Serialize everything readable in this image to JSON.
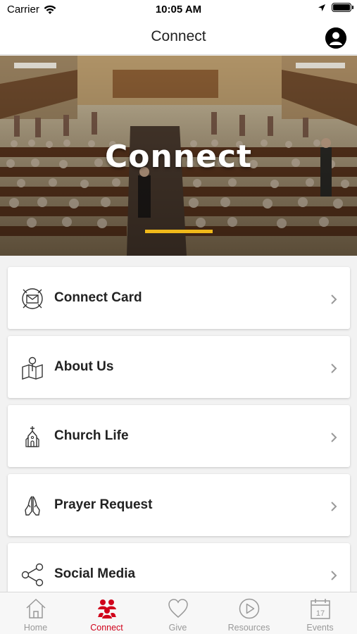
{
  "status_bar": {
    "carrier": "Carrier",
    "time": "10:05 AM"
  },
  "nav": {
    "title": "Connect"
  },
  "hero": {
    "title": "Connect",
    "accent_color": "#f0b91a"
  },
  "menu": {
    "items": [
      {
        "label": "Connect Card",
        "icon": "connect-card-icon"
      },
      {
        "label": "About Us",
        "icon": "map-pin-icon"
      },
      {
        "label": "Church Life",
        "icon": "church-icon"
      },
      {
        "label": "Prayer Request",
        "icon": "praying-hands-icon"
      },
      {
        "label": "Social Media",
        "icon": "share-icon"
      }
    ]
  },
  "tabs": {
    "active_color": "#d0021b",
    "items": [
      {
        "label": "Home",
        "icon": "home-icon"
      },
      {
        "label": "Connect",
        "icon": "people-icon"
      },
      {
        "label": "Give",
        "icon": "heart-icon"
      },
      {
        "label": "Resources",
        "icon": "play-icon"
      },
      {
        "label": "Events",
        "icon": "calendar-icon",
        "day": "17"
      }
    ]
  }
}
